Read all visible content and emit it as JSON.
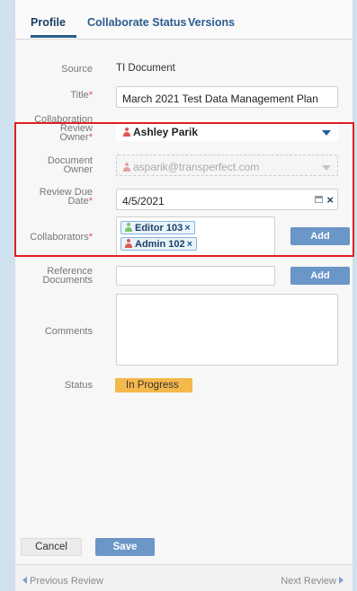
{
  "tabs": [
    "Profile",
    "Collaborate Status",
    "Versions"
  ],
  "fields": {
    "source": {
      "label": "Source",
      "value": "TI Document"
    },
    "title": {
      "label": "Title",
      "required": "*",
      "value": "March 2021 Test Data Management Plan"
    },
    "collab_owner": {
      "label_line1": "Collaboration",
      "label_line2": "Review",
      "label_line3": "Owner",
      "required": "*",
      "value": "Ashley Parik"
    },
    "document_owner": {
      "label_line1": "Document",
      "label_line2": "Owner",
      "value": "asparik@transperfect.com"
    },
    "review_due": {
      "label_line1": "Review Due",
      "label_line2": "Date",
      "required": "*",
      "value": "4/5/2021",
      "clear": "×"
    },
    "collaborators": {
      "label": "Collaborators",
      "required": "*",
      "chips": [
        "Editor 103",
        "Admin 102"
      ],
      "chip_remove": "×",
      "add_label": "Add"
    },
    "reference_documents": {
      "label_line1": "Reference",
      "label_line2": "Documents",
      "value": "",
      "add_label": "Add"
    },
    "comments": {
      "label": "Comments",
      "value": ""
    },
    "status": {
      "label": "Status",
      "value": "In Progress",
      "color": "#f5b84a"
    }
  },
  "actions": {
    "cancel": "Cancel",
    "save": "Save"
  },
  "footer": {
    "previous": "Previous Review",
    "next": "Next Review"
  },
  "colors": {
    "accent": "#2a5c8f",
    "button": "#6a96c8",
    "highlight": "#e01f1f",
    "required": "#d9534f"
  }
}
